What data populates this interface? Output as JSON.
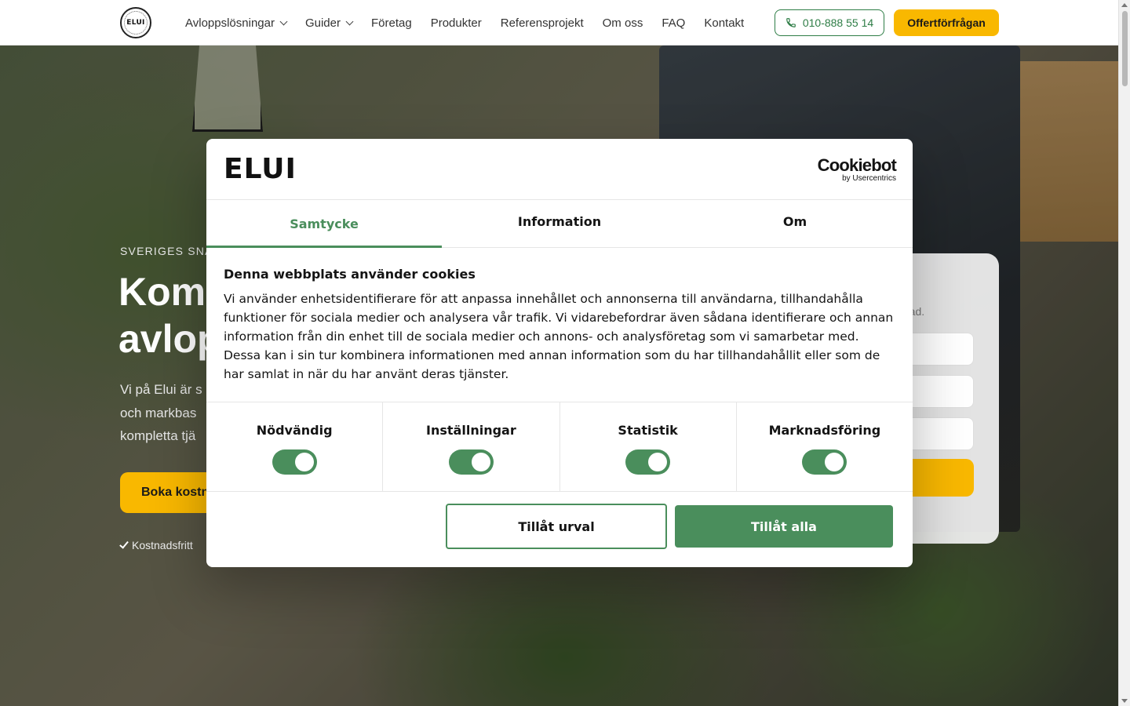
{
  "header": {
    "logo_text": "ELUI",
    "nav": [
      {
        "label": "Avloppslösningar",
        "dropdown": true
      },
      {
        "label": "Guider",
        "dropdown": true
      },
      {
        "label": "Företag",
        "dropdown": false
      },
      {
        "label": "Produkter",
        "dropdown": false
      },
      {
        "label": "Referensprojekt",
        "dropdown": false
      },
      {
        "label": "Om oss",
        "dropdown": false
      },
      {
        "label": "FAQ",
        "dropdown": false
      },
      {
        "label": "Kontakt",
        "dropdown": false
      }
    ],
    "phone": "010-888 55 14",
    "offer_button": "Offertförfrågan"
  },
  "hero": {
    "eyebrow": "SVERIGES SNA",
    "title_line1": "Komp",
    "title_line2": "avlop",
    "text_line1": "Vi på Elui är s",
    "text_line2": "och markbas",
    "text_line3": "kompletta tjä",
    "cta": "Boka kostn",
    "check": "Kostnadsfritt"
  },
  "form": {
    "subtitle_fragment": "stnad."
  },
  "cookie_dialog": {
    "brand": "ELUI",
    "provider_main": "Cookiebot",
    "provider_sub": "by Usercentrics",
    "tabs": [
      {
        "label": "Samtycke",
        "active": true
      },
      {
        "label": "Information",
        "active": false
      },
      {
        "label": "Om",
        "active": false
      }
    ],
    "heading": "Denna webbplats använder cookies",
    "body": "Vi använder enhetsidentifierare för att anpassa innehållet och annonserna till användarna, tillhandahålla funktioner för sociala medier och analysera vår trafik. Vi vidarebefordrar även sådana identifierare och annan information från din enhet till de sociala medier och annons- och analysföretag som vi samarbetar med. Dessa kan i sin tur kombinera informationen med annan information som du har tillhandahållit eller som de har samlat in när du har använt deras tjänster.",
    "toggles": [
      {
        "label": "Nödvändig",
        "on": true
      },
      {
        "label": "Inställningar",
        "on": true
      },
      {
        "label": "Statistik",
        "on": true
      },
      {
        "label": "Marknadsföring",
        "on": true
      }
    ],
    "btn_select": "Tillåt urval",
    "btn_all": "Tillåt alla"
  },
  "colors": {
    "accent_green": "#4a8e5c",
    "brand_yellow": "#f9b800",
    "phone_green": "#2e7d46"
  },
  "icons": {
    "phone": "phone-icon",
    "chevron": "chevron-down-icon",
    "check": "check-icon"
  }
}
